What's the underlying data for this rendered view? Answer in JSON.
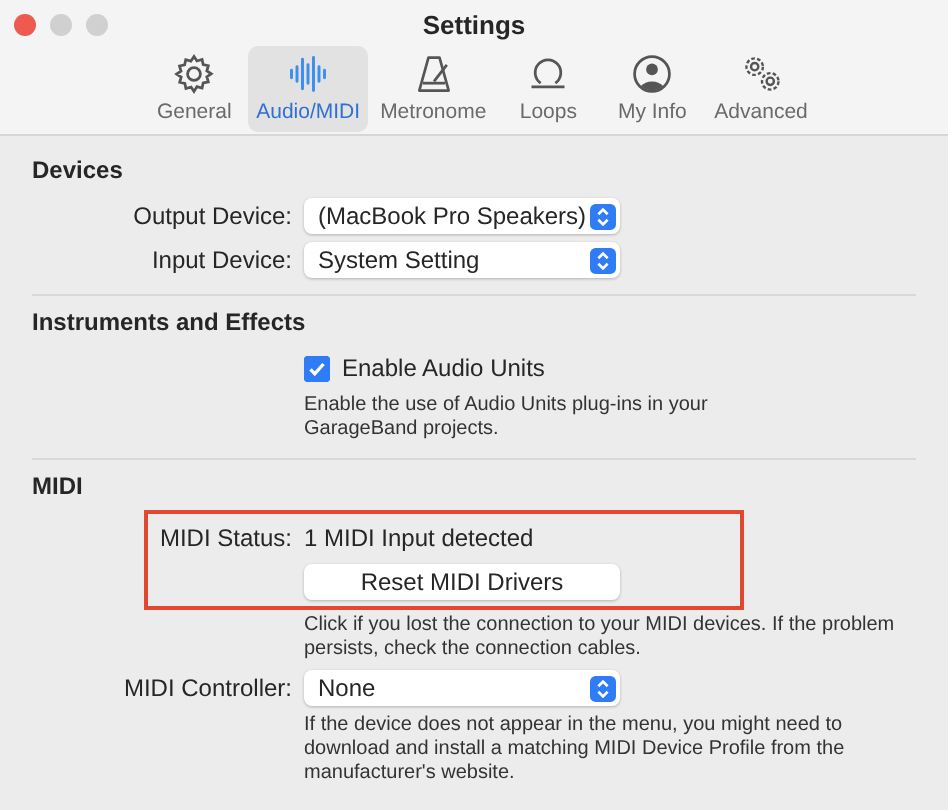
{
  "window": {
    "title": "Settings"
  },
  "tabs": [
    {
      "label": "General",
      "selected": false
    },
    {
      "label": "Audio/MIDI",
      "selected": true
    },
    {
      "label": "Metronome",
      "selected": false
    },
    {
      "label": "Loops",
      "selected": false
    },
    {
      "label": "My Info",
      "selected": false
    },
    {
      "label": "Advanced",
      "selected": false
    }
  ],
  "sections": [
    {
      "title": "Devices",
      "rows": [
        {
          "kind": "select",
          "label": "Output Device:",
          "value": "(MacBook Pro Speakers)"
        },
        {
          "kind": "select",
          "label": "Input Device:",
          "value": "System Setting"
        }
      ]
    },
    {
      "title": "Instruments and Effects",
      "rows": [
        {
          "kind": "checkbox",
          "text": "Enable Audio Units",
          "checked": true
        },
        {
          "kind": "note",
          "text": "Enable the use of Audio Units plug-ins in your GarageBand projects."
        }
      ]
    },
    {
      "title": "MIDI",
      "rows": [
        {
          "kind": "highlight",
          "highlighted": true,
          "rows": [
            {
              "kind": "status",
              "label": "MIDI Status:",
              "value": "1 MIDI Input detected"
            },
            {
              "kind": "button",
              "text": "Reset MIDI Drivers"
            }
          ]
        },
        {
          "kind": "note",
          "text": "Click if you lost the connection to your MIDI devices. If the problem persists, check the connection cables."
        },
        {
          "kind": "select",
          "label": "MIDI Controller:",
          "value": "None"
        },
        {
          "kind": "note",
          "text": "If the device does not appear in the menu, you might need to download and install a matching MIDI Device Profile from the manufacturer's website."
        }
      ]
    }
  ]
}
